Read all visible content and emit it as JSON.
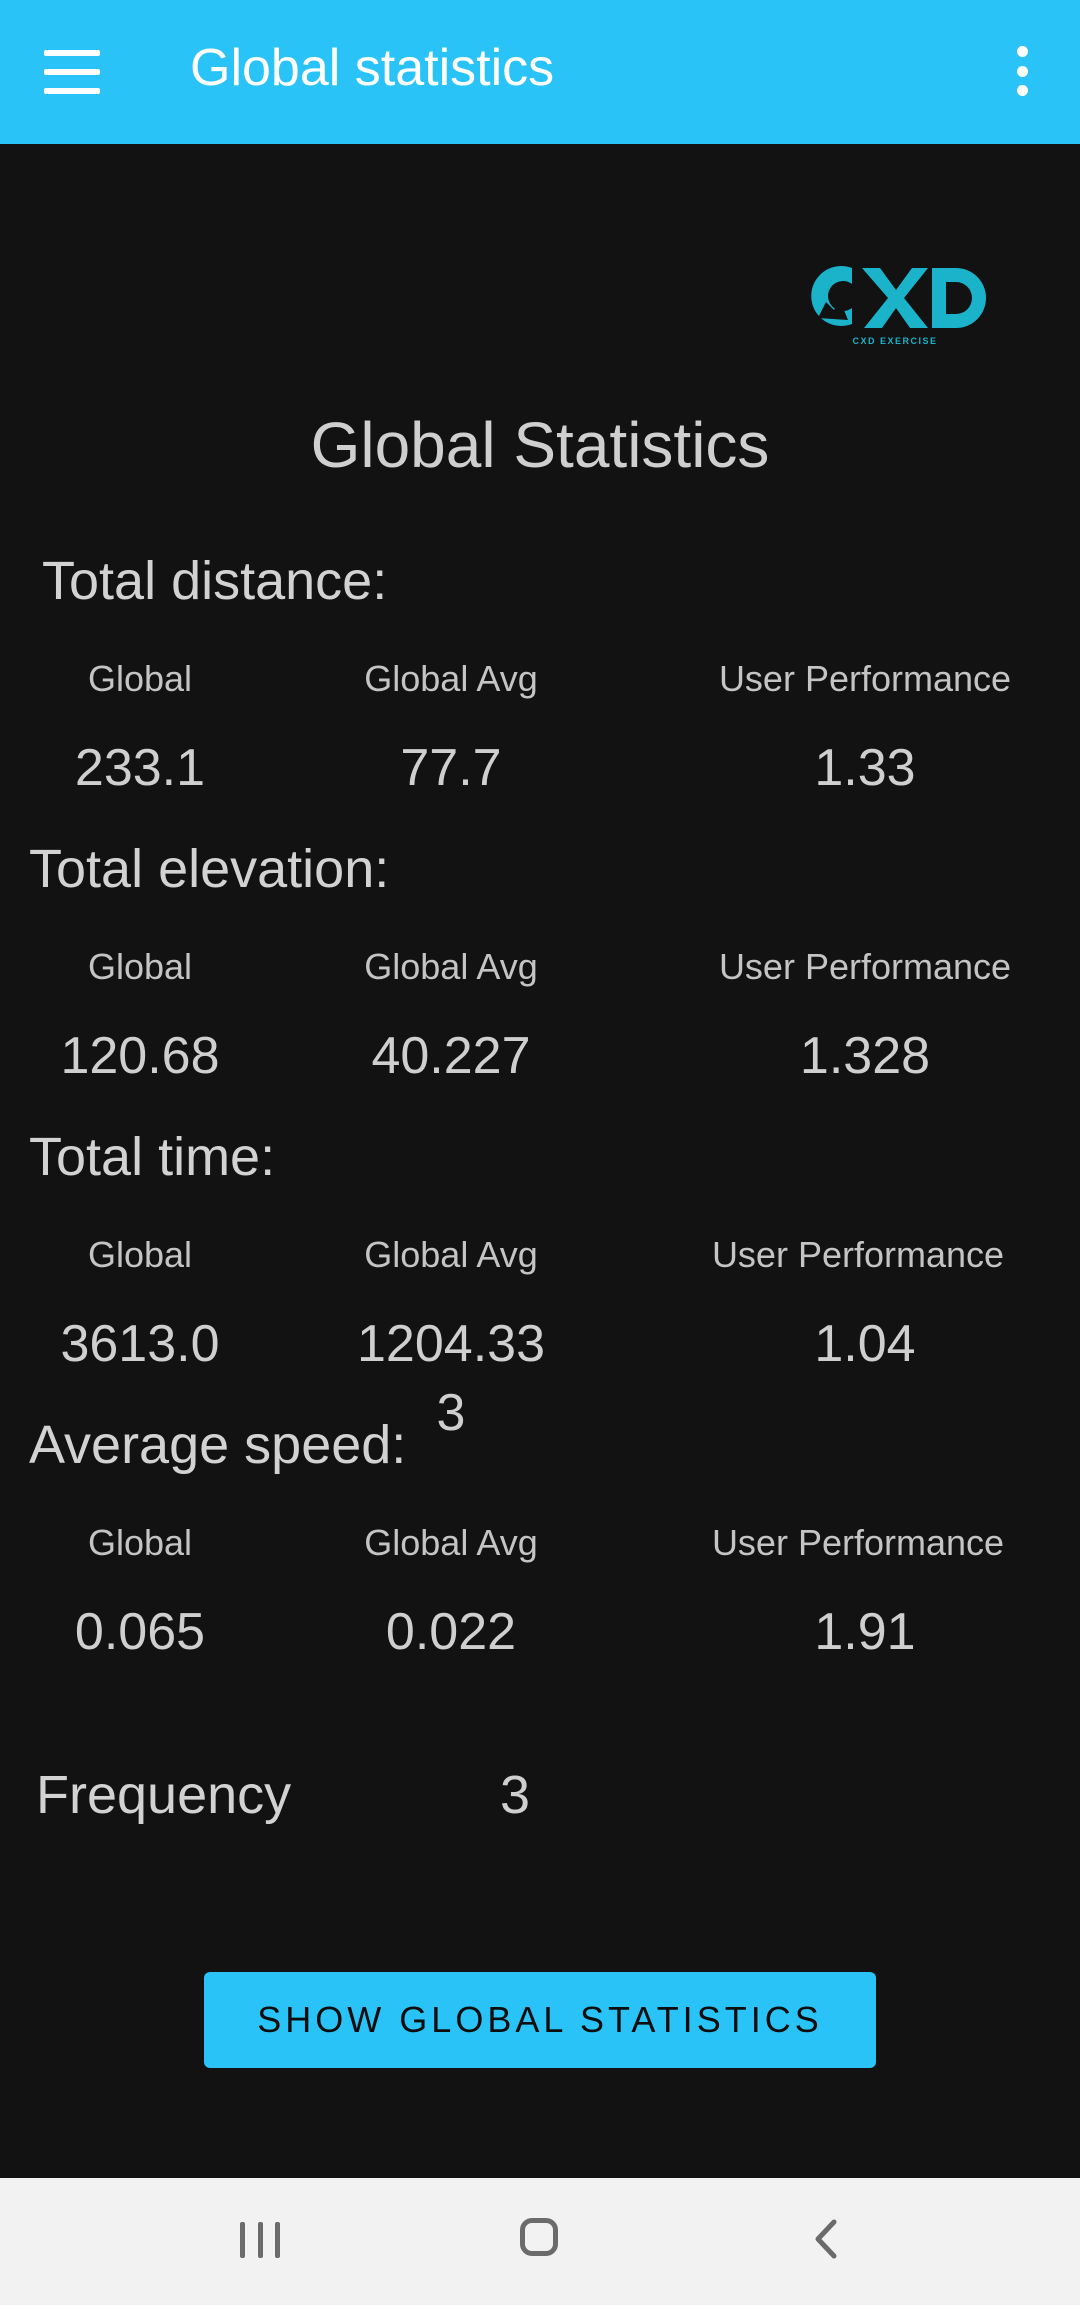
{
  "appbar": {
    "title": "Global statistics",
    "menu_icon": "hamburger-menu-icon",
    "overflow_icon": "more-vertical-icon",
    "color": "#29c3f7"
  },
  "logo": {
    "text": "CXD",
    "tagline": "CXD EXERCISE",
    "color": "#1ab3c9"
  },
  "page_title": "Global Statistics",
  "sections": [
    {
      "label": "Total distance:",
      "headers": [
        "Global",
        "Global Avg",
        "User Performance"
      ],
      "values": [
        "233.1",
        "77.7",
        "1.33"
      ]
    },
    {
      "label": "Total elevation:",
      "headers": [
        "Global",
        "Global Avg",
        "User Performance"
      ],
      "values": [
        "120.68",
        "40.227",
        "1.328"
      ]
    },
    {
      "label": "Total time:",
      "headers": [
        "Global",
        "Global Avg",
        "User Performance"
      ],
      "values": [
        "3613.0",
        "1204.33",
        "1.04"
      ],
      "value_overflow": "3"
    },
    {
      "label": "Average speed:",
      "headers": [
        "Global",
        "Global Avg",
        "User Performance"
      ],
      "values": [
        "0.065",
        "0.022",
        "1.91"
      ]
    }
  ],
  "frequency": {
    "label": "Frequency",
    "value": "3"
  },
  "show_button": {
    "label": "SHOW GLOBAL STATISTICS"
  },
  "navbar": {
    "recent_icon": "recent-apps-icon",
    "home_icon": "home-icon",
    "back_icon": "back-icon"
  }
}
